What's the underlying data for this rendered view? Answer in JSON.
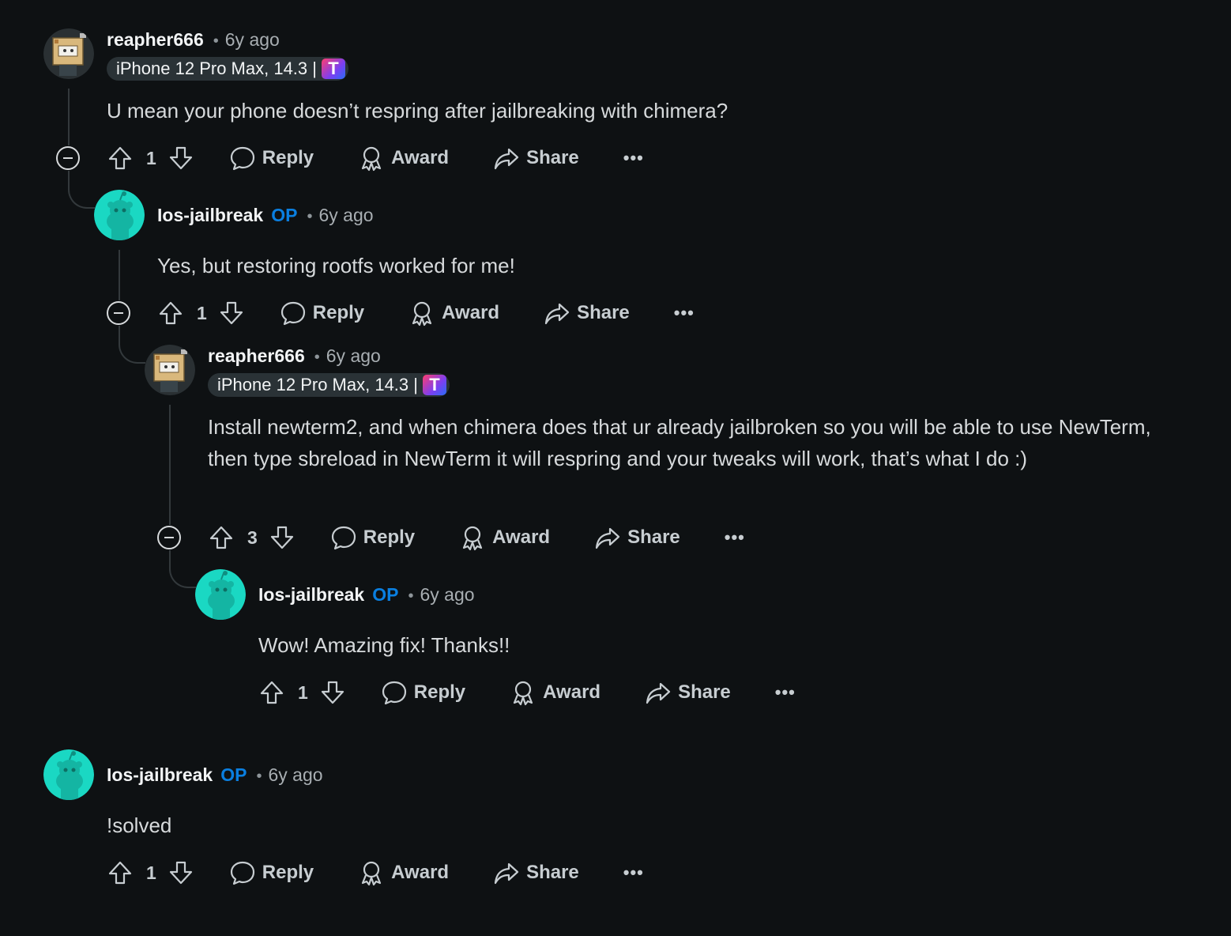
{
  "comments": [
    {
      "username": "reapher666",
      "time": "6y ago",
      "flair_text": "iPhone 12 Pro Max, 14.3 |",
      "flair_badge": "T",
      "body": "U mean your phone doesn’t respring after jailbreaking with chimera?",
      "score": "1"
    },
    {
      "username": "Ios-jailbreak",
      "op": "OP",
      "time": "6y ago",
      "body": "Yes, but restoring rootfs worked for me!",
      "score": "1"
    },
    {
      "username": "reapher666",
      "time": "6y ago",
      "flair_text": "iPhone 12 Pro Max, 14.3 |",
      "flair_badge": "T",
      "body": "Install newterm2, and when chimera does that ur already jailbroken so you will be able to use NewTerm, then type sbreload in NewTerm it will respring and your tweaks will work, that’s what I do :)",
      "score": "3"
    },
    {
      "username": "Ios-jailbreak",
      "op": "OP",
      "time": "6y ago",
      "body": "Wow! Amazing fix! Thanks!!",
      "score": "1"
    },
    {
      "username": "Ios-jailbreak",
      "op": "OP",
      "time": "6y ago",
      "body": "!solved",
      "score": "1"
    }
  ],
  "actions": {
    "reply": "Reply",
    "award": "Award",
    "share": "Share",
    "more": "•••"
  },
  "icons": {
    "upvote": "upvote-arrow-icon",
    "downvote": "downvote-arrow-icon",
    "reply": "speech-bubble-icon",
    "award": "award-ribbon-icon",
    "share": "share-arrow-icon",
    "collapse": "minus-circle-icon"
  },
  "colors": {
    "background": "#0e1113",
    "op": "#0a7fe0",
    "snoo_avatar": "#1ad8c3"
  }
}
